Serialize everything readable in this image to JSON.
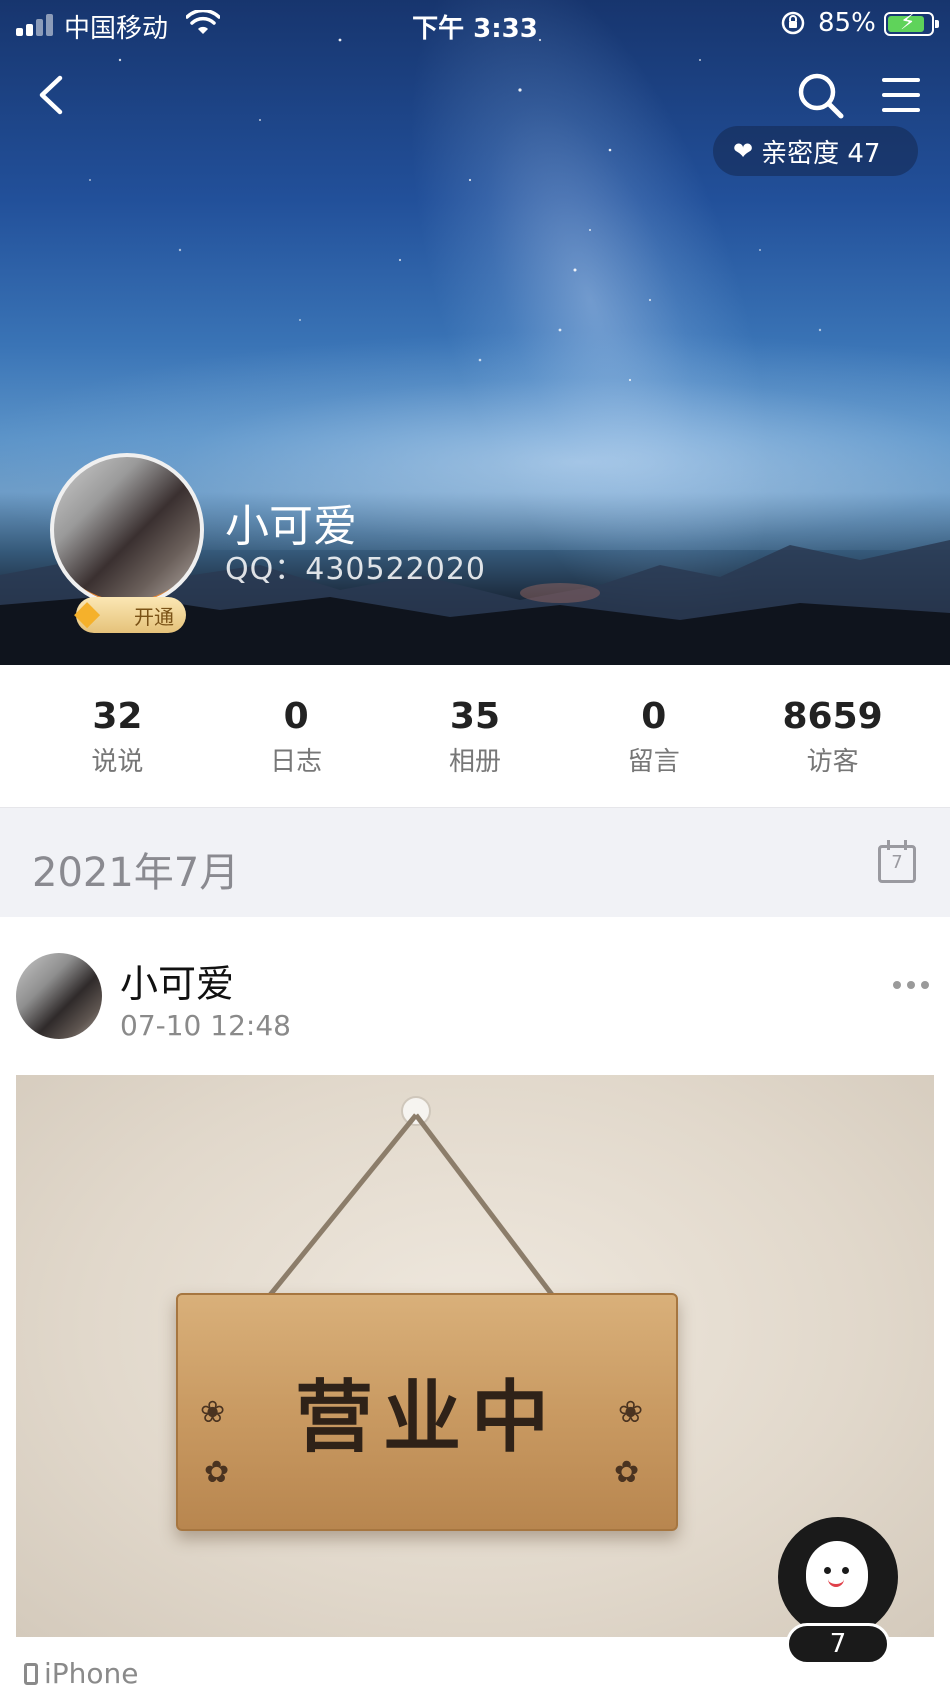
{
  "status_bar": {
    "carrier": "中国移动",
    "time": "下午 3:33",
    "battery": "85%"
  },
  "header": {
    "intimacy_label": "亲密度 47",
    "vip_label": "开通"
  },
  "profile": {
    "name": "小可爱",
    "qq": "QQ：430522020"
  },
  "stats": [
    {
      "value": "32",
      "label": "说说"
    },
    {
      "value": "0",
      "label": "日志"
    },
    {
      "value": "35",
      "label": "相册"
    },
    {
      "value": "0",
      "label": "留言"
    },
    {
      "value": "8659",
      "label": "访客"
    }
  ],
  "timeline": {
    "date": "2021年7月",
    "calendar_day": "7"
  },
  "post": {
    "author": "小可爱",
    "time": "07-10 12:48",
    "image_text": "营业中",
    "device": "iPhone"
  },
  "floating": {
    "count": "7"
  },
  "icons": {
    "back": "back-arrow-icon",
    "search": "search-icon",
    "menu": "menu-icon",
    "heart": "heart-icon",
    "calendar": "calendar-icon",
    "more": "more-dots-icon"
  },
  "colors": {
    "battery_fill": "#5fd35a",
    "vip_gold": "#e5c27a",
    "date_bar_bg": "#f1f2f6"
  }
}
